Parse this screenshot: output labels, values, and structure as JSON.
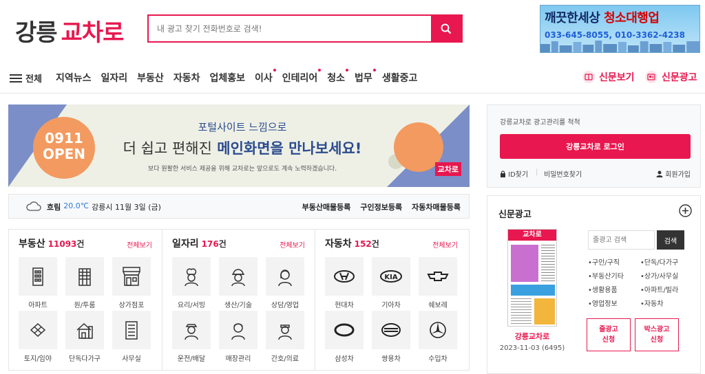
{
  "header": {
    "logo_part1": "강릉",
    "logo_part2": "교차로",
    "search_placeholder": "내 광고 찾기 전화번호로 검색!",
    "ad_line1_prefix": "깨끗한세상",
    "ad_line1_highlight": "청소대행업",
    "ad_line2": "033-645-8055, 010-3362-4238"
  },
  "nav": {
    "all_label": "전체",
    "items": [
      {
        "label": "지역뉴스",
        "dot": false
      },
      {
        "label": "일자리",
        "dot": false
      },
      {
        "label": "부동산",
        "dot": false
      },
      {
        "label": "자동차",
        "dot": false
      },
      {
        "label": "업체홍보",
        "dot": false
      },
      {
        "label": "이사",
        "dot": true
      },
      {
        "label": "인테리어",
        "dot": true
      },
      {
        "label": "청소",
        "dot": true
      },
      {
        "label": "법무",
        "dot": true
      },
      {
        "label": "생활중고",
        "dot": false
      }
    ],
    "newspaper_label": "신문보기",
    "newspaper_ad_label": "신문광고"
  },
  "banner": {
    "open_date": "0911",
    "open_word": "OPEN",
    "line1": "포털사이트 느낌으로",
    "line2_prefix": "더 쉽고 편해진",
    "line2_highlight": "메인화면을 만나보세요!",
    "line3": "보다 원활한 서비스 제공을 위해 교차로는 앞으로도 계속 노력하겠습니다.",
    "badge": "교차로"
  },
  "weather": {
    "condition": "흐림",
    "temperature": "20.0℃",
    "location_date": "강릉시 11월 3일 (금)",
    "links": [
      "부동산매물등록",
      "구인정보등록",
      "자동차매물등록"
    ]
  },
  "categories": [
    {
      "title": "부동산",
      "count": "11093",
      "unit": "건",
      "more": "전체보기",
      "items": [
        {
          "label": "아파트",
          "icon": "apartment-icon"
        },
        {
          "label": "원/투룸",
          "icon": "building-icon"
        },
        {
          "label": "상가점포",
          "icon": "market-icon"
        },
        {
          "label": "토지/임야",
          "icon": "land-icon"
        },
        {
          "label": "단독다가구",
          "icon": "house-icon"
        },
        {
          "label": "사무실",
          "icon": "office-icon"
        }
      ]
    },
    {
      "title": "일자리",
      "count": "176",
      "unit": "건",
      "more": "전체보기",
      "items": [
        {
          "label": "요리/서빙",
          "icon": "chef-icon"
        },
        {
          "label": "생산/기술",
          "icon": "worker-icon"
        },
        {
          "label": "상담/영업",
          "icon": "consultant-icon"
        },
        {
          "label": "운전/배달",
          "icon": "driver-icon"
        },
        {
          "label": "매장관리",
          "icon": "clerk-icon"
        },
        {
          "label": "간호/의료",
          "icon": "nurse-icon"
        }
      ]
    },
    {
      "title": "자동차",
      "count": "152",
      "unit": "건",
      "more": "전체보기",
      "items": [
        {
          "label": "현대차",
          "icon": "hyundai-logo-icon"
        },
        {
          "label": "기아차",
          "icon": "kia-logo-icon"
        },
        {
          "label": "쉐보레",
          "icon": "chevrolet-logo-icon"
        },
        {
          "label": "삼성차",
          "icon": "samsung-logo-icon"
        },
        {
          "label": "쌍용차",
          "icon": "ssangyong-logo-icon"
        },
        {
          "label": "수입차",
          "icon": "benz-logo-icon"
        }
      ]
    }
  ],
  "login": {
    "message": "강릉교차로 광고관리를 척척",
    "button": "강릉교차로 로그인",
    "find_id": "ID찾기",
    "find_pw": "비밀번호찾기",
    "signup": "회원가입"
  },
  "paper": {
    "title": "신문광고",
    "name": "강릉교차로",
    "issue": "2023-11-03 (6495)",
    "thumb_title": "교차로",
    "search_placeholder": "줄광고 검색",
    "search_button": "검색",
    "links": [
      "•구인/구직",
      "•단독/다가구",
      "•부동산기타",
      "•상가/사무실",
      "•생활용품",
      "•아파트/빌라",
      "•영업정보",
      "•자동차"
    ],
    "line_ad_button": "줄광고\n신청",
    "box_ad_button": "박스광고\n신청"
  },
  "colors": {
    "accent": "#e8174f",
    "banner_blue": "#2c4b8e",
    "banner_orange": "#f39a60"
  }
}
